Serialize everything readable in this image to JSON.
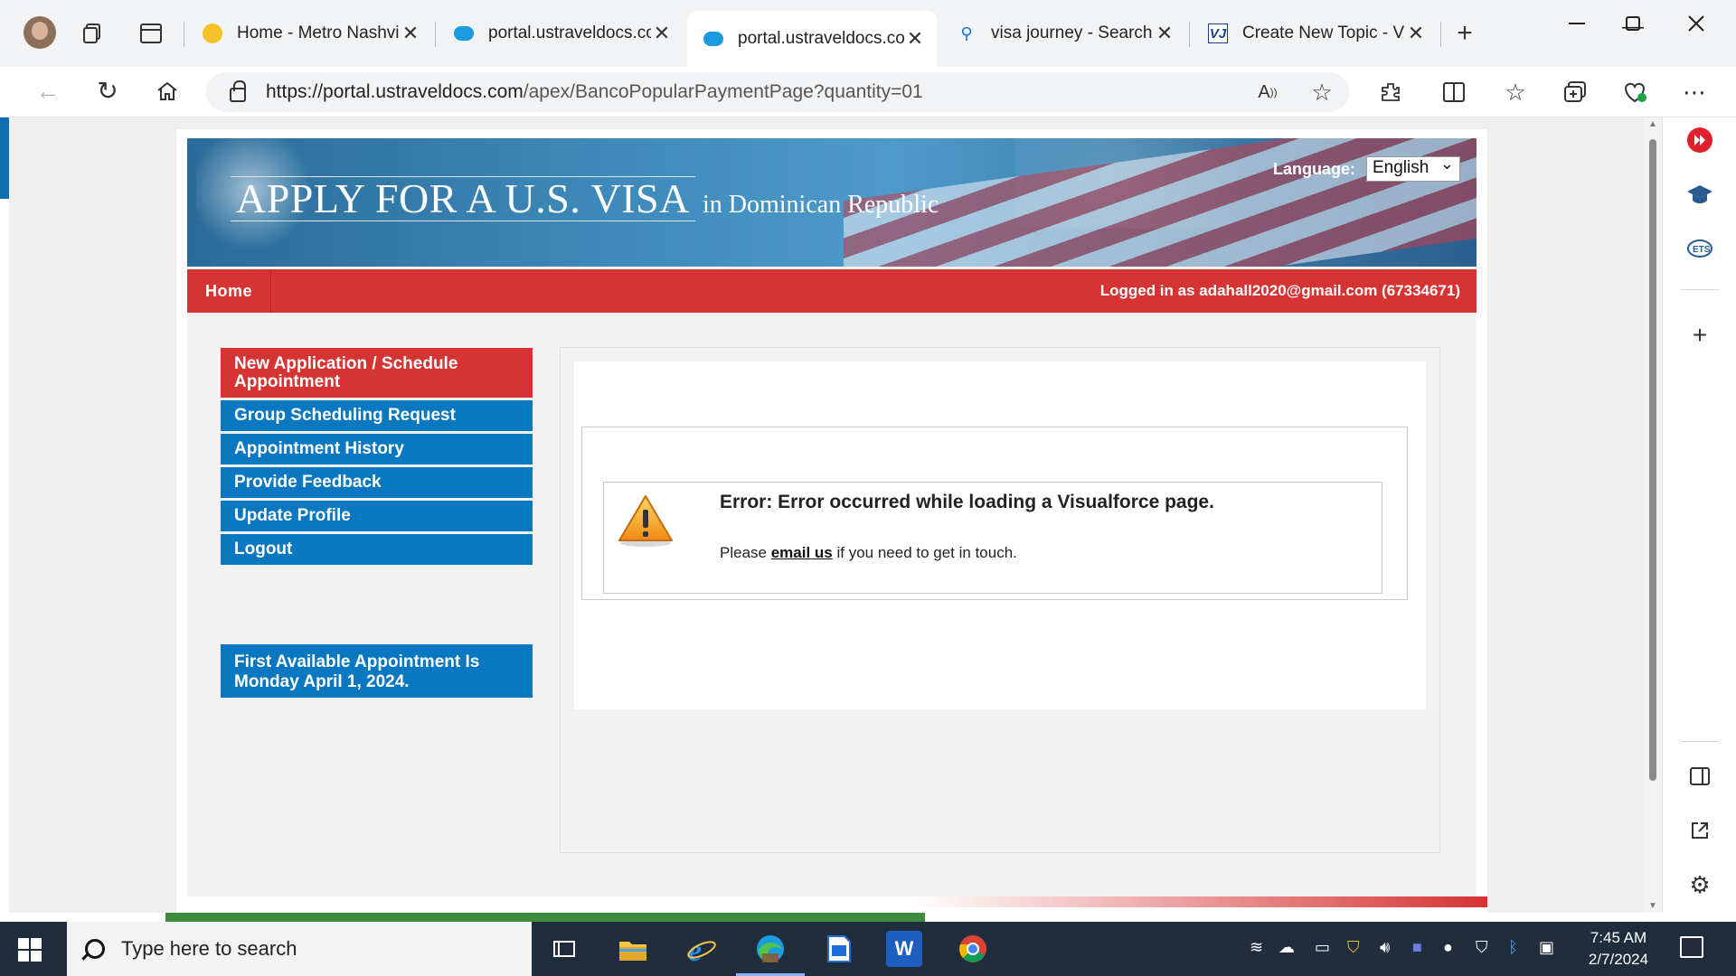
{
  "browser": {
    "tabs": [
      {
        "title": "Home - Metro Nashvill",
        "favicon": "metro-logo"
      },
      {
        "title": "portal.ustraveldocs.com",
        "favicon": "salesforce-cloud"
      },
      {
        "title": "portal.ustraveldocs.com",
        "favicon": "salesforce-cloud",
        "active": true
      },
      {
        "title": "visa journey - Search",
        "favicon": "bing-search"
      },
      {
        "title": "Create New Topic - Vis",
        "favicon": "vj-logo"
      }
    ],
    "url_host": "https://portal.ustraveldocs.com",
    "url_path": "/apex/BancoPopularPaymentPage?quantity=01",
    "favicon_vj_text": "VJ"
  },
  "page": {
    "banner_title": "APPLY FOR A U.S. VISA",
    "banner_country": "in  Dominican Republic",
    "language_label": "Language:",
    "language_value": "English",
    "nav_home": "Home",
    "logged_in": "Logged in as  adahall2020@gmail.com (67334671)",
    "menu": [
      "New Application / Schedule Appointment",
      "Group Scheduling Request",
      "Appointment History",
      "Provide Feedback",
      "Update Profile",
      "Logout"
    ],
    "appointment_notice": "First Available Appointment Is Monday April 1, 2024.",
    "error_title": "Error: Error occurred while loading a Visualforce page.",
    "error_msg_prefix": "Please ",
    "error_msg_link": "email us",
    "error_msg_suffix": " if you need to get in touch."
  },
  "taskbar": {
    "search_placeholder": "Type here to search",
    "time": "7:45 AM",
    "date": "2/7/2024",
    "word_label": "W"
  },
  "colors": {
    "nav_red": "#d63333",
    "menu_blue": "#0a78c0",
    "taskbar": "#1f2d3d"
  }
}
